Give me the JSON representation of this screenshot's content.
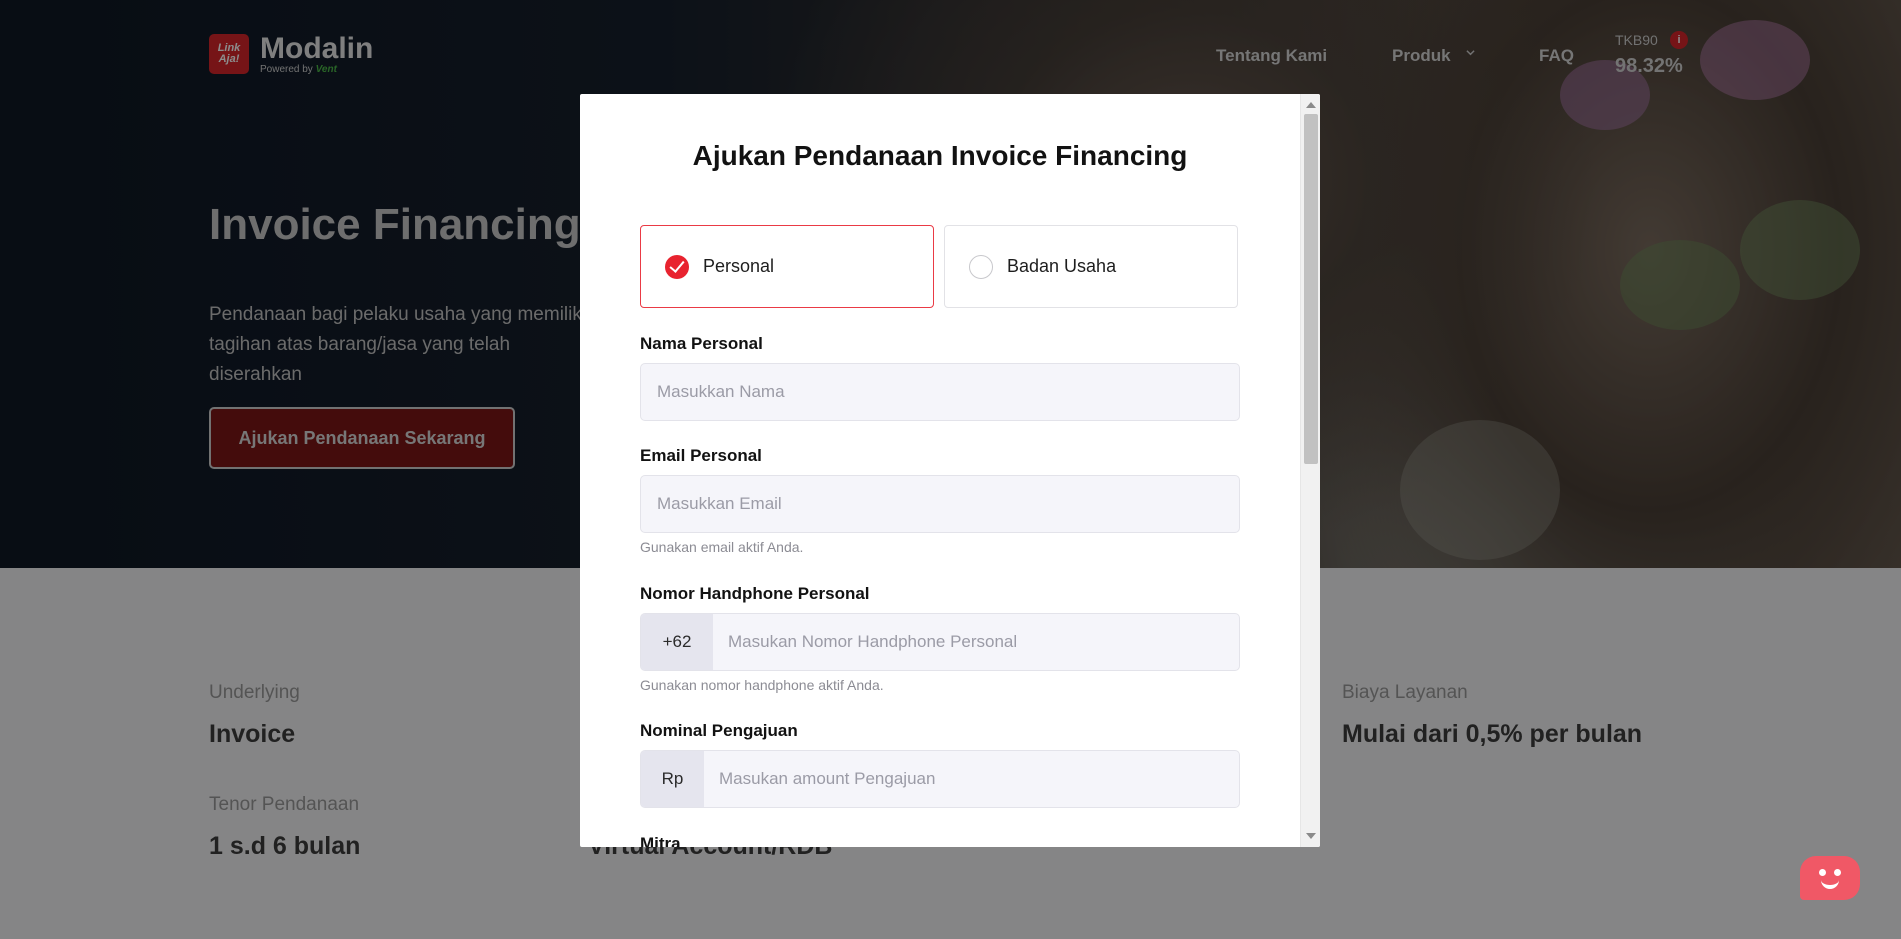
{
  "brand": {
    "logo_text": "Link Aja!",
    "name": "Modalin",
    "powered_by": "Powered by",
    "powered_brand": "Vent"
  },
  "nav": {
    "about": "Tentang Kami",
    "product": "Produk",
    "faq": "FAQ",
    "tkb_label": "TKB90",
    "tkb_info": "i",
    "tkb_value": "98.32%"
  },
  "hero": {
    "title": "Invoice Financing",
    "description": "Pendanaan bagi pelaku usaha yang memiliki tagihan atas barang/jasa yang telah diserahkan",
    "cta": "Ajukan Pendanaan Sekarang"
  },
  "info": {
    "underlying_label": "Underlying",
    "underlying_value": "Invoice",
    "fee_label": "Biaya Layanan",
    "fee_value": "Mulai dari 0,5% per bulan",
    "tenor_label": "Tenor Pendanaan",
    "tenor_value": "1 s.d 6 bulan",
    "mid_value": "Virtual Account/RDB"
  },
  "modal": {
    "title": "Ajukan Pendanaan Invoice Financing",
    "type_personal": "Personal",
    "type_business": "Badan Usaha",
    "selected_type": "Personal",
    "name_label": "Nama Personal",
    "name_placeholder": "Masukkan Nama",
    "email_label": "Email Personal",
    "email_placeholder": "Masukkan Email",
    "email_help": "Gunakan email aktif Anda.",
    "phone_label": "Nomor Handphone Personal",
    "phone_prefix": "+62",
    "phone_placeholder": "Masukan Nomor Handphone Personal",
    "phone_help": "Gunakan nomor handphone aktif Anda.",
    "amount_label": "Nominal Pengajuan",
    "amount_prefix": "Rp",
    "amount_placeholder": "Masukan amount Pengajuan",
    "next_label": "Mitra"
  },
  "colors": {
    "accent": "#e8232f",
    "brand_red": "#d8262b",
    "input_bg": "#f5f5fa"
  },
  "icons": {
    "chevron": "chevron-down-icon",
    "check": "check-icon",
    "info": "info-icon",
    "chat": "chat-bot-icon"
  }
}
